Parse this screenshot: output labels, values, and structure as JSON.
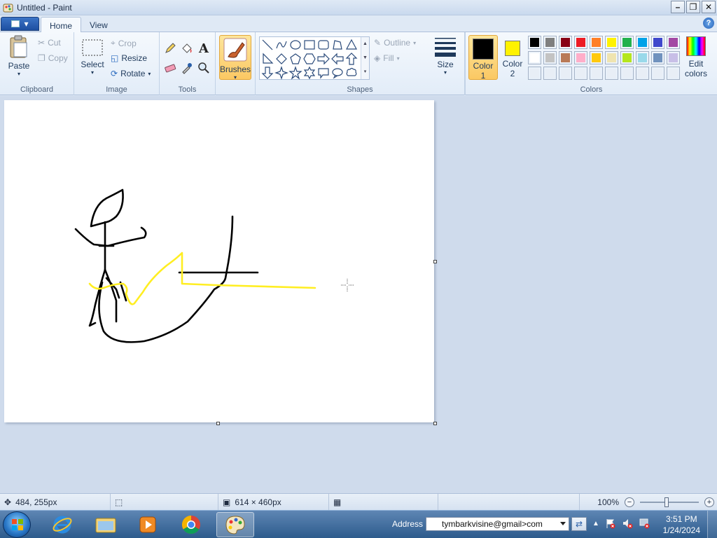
{
  "window": {
    "title": "Untitled - Paint",
    "minimize": "–",
    "restore": "❐",
    "close": "✕"
  },
  "tabs": [
    {
      "label": "Home",
      "active": true
    },
    {
      "label": "View",
      "active": false
    }
  ],
  "help_glyph": "?",
  "ribbon": {
    "clipboard": {
      "paste": "Paste",
      "cut": "Cut",
      "copy": "Copy",
      "label": "Clipboard"
    },
    "image": {
      "select": "Select",
      "crop": "Crop",
      "resize": "Resize",
      "rotate": "Rotate",
      "label": "Image"
    },
    "tools": {
      "label": "Tools",
      "text_glyph": "A"
    },
    "brushes": {
      "label": "Brushes"
    },
    "shapes": {
      "outline": "Outline",
      "fill": "Fill",
      "label": "Shapes"
    },
    "size": {
      "label": "Size"
    },
    "colors": {
      "color1": {
        "label1": "Color",
        "label2": "1",
        "value": "#000000"
      },
      "color2": {
        "label1": "Color",
        "label2": "2",
        "value": "#fff200"
      },
      "edit1": "Edit",
      "edit2": "colors",
      "label": "Colors",
      "palette_row1": [
        "#000000",
        "#7f7f7f",
        "#880015",
        "#ed1c24",
        "#ff7f27",
        "#fff200",
        "#22b14c",
        "#00a2e8",
        "#3f48cc",
        "#a349a4"
      ],
      "palette_row2": [
        "#ffffff",
        "#c3c3c3",
        "#b97a57",
        "#ffaec9",
        "#ffc90e",
        "#efe4b0",
        "#b5e61d",
        "#99d9ea",
        "#7092be",
        "#c8bfe7"
      ],
      "palette_row3": [
        "",
        "",
        "",
        "",
        "",
        "",
        "",
        "",
        "",
        ""
      ]
    }
  },
  "status": {
    "cursor_pos": "484, 255px",
    "selection_size": "",
    "image_size": "614 × 460px",
    "zoom": "100%",
    "zoom_out": "−",
    "zoom_in": "+"
  },
  "taskbar": {
    "address_label": "Address",
    "address_value": "tymbarkvisine@gmail>com",
    "time": "3:51 PM",
    "date": "1/24/2024"
  }
}
